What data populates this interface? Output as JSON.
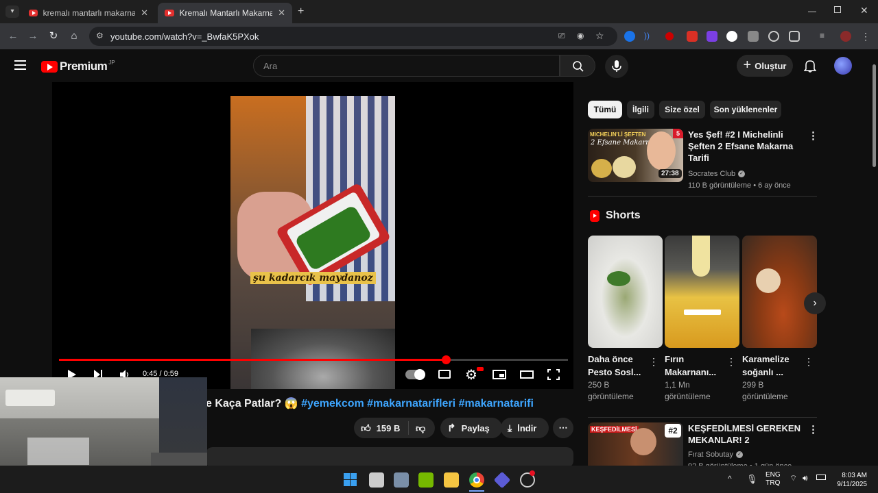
{
  "browser": {
    "tabs": [
      {
        "title": "kremalı mantarlı makarna - You",
        "active": false
      },
      {
        "title": "Kremalı Mantarlı Makarna Evde",
        "active": true
      }
    ],
    "url": "youtube.com/watch?v=_BwfaK5PXok"
  },
  "youtube": {
    "logo_text": "Premium",
    "region": "JP",
    "search_placeholder": "Ara",
    "create_label": "Oluştur"
  },
  "player": {
    "caption": "şu kadarcık maydanoz",
    "time": "0:45 / 0:59",
    "progress_fraction": 0.76
  },
  "video": {
    "title_prefix": "e Kaça Patlar? 😱 ",
    "tags": "#yemekcom #makarnatarifleri #makarnatarifi",
    "likes": "159 B",
    "share_label": "Paylaş",
    "download_label": "İndir"
  },
  "sidebar": {
    "chips": [
      "Tümü",
      "İlgili",
      "Size özel",
      "Son yüklenenler"
    ],
    "videos": [
      {
        "title": "Yes Şef! #2 I  Michelinli Şeften 2 Efsane Makarna Tarifi",
        "channel": "Socrates Club",
        "meta": "110 B görüntüleme • 6 ay önce",
        "duration": "27:38",
        "thumb_text": "MICHELIN'Lİ ŞEFTEN",
        "thumb_subtext": "2 Efsane Makarna"
      },
      {
        "title": "KEŞFEDİLMESİ GEREKEN MEKANLAR! 2",
        "channel": "Fırat Sobutay",
        "meta": "92 B görüntüleme • 1 gün önce",
        "thumb_text": "KEŞFEDİLMESİ",
        "thumb_badge": "#2"
      }
    ],
    "shorts_heading": "Shorts",
    "shorts": [
      {
        "title1": "Daha önce",
        "title2": "Pesto Sosl...",
        "views": "250 B",
        "views_label": "görüntüleme"
      },
      {
        "title1": "Fırın",
        "title2": "Makarnanı...",
        "views": "1,1 Mn",
        "views_label": "görüntüleme"
      },
      {
        "title1": "Karamelize",
        "title2": "soğanlı ...",
        "views": "299 B",
        "views_label": "görüntüleme"
      }
    ]
  },
  "taskbar": {
    "lang1": "ENG",
    "lang2": "TRQ",
    "time": "8:03 AM",
    "date": "9/11/2025"
  },
  "colors": {
    "brand_red": "#ff0000",
    "link_blue": "#3ea6ff",
    "background": "#0f0f0f"
  }
}
